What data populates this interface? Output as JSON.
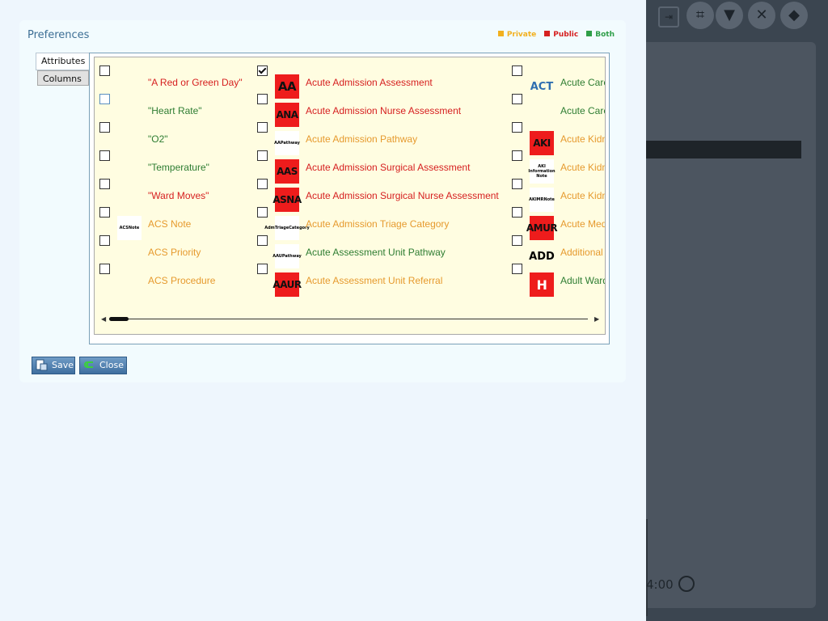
{
  "dialog": {
    "title": "Preferences",
    "legend": [
      {
        "label": "Private",
        "color": "#f2b01e"
      },
      {
        "label": "Public",
        "color": "#d62020"
      },
      {
        "label": "Both",
        "color": "#2e9e48"
      }
    ],
    "tabs": [
      {
        "label": "Attributes",
        "active": true
      },
      {
        "label": "Columns",
        "active": false
      }
    ],
    "buttons": {
      "save": "Save",
      "close": "Close"
    }
  },
  "columns": [
    {
      "items": [
        {
          "label": "\"A Red or Green Day\"",
          "scope": "public",
          "checked": false,
          "icon": null
        },
        {
          "label": "\"Heart Rate\"",
          "scope": "both",
          "checked": false,
          "icon": null
        },
        {
          "label": "\"O2\"",
          "scope": "both",
          "checked": false,
          "icon": null
        },
        {
          "label": "\"Temperature\"",
          "scope": "both",
          "checked": false,
          "icon": null
        },
        {
          "label": "\"Ward Moves\"",
          "scope": "public",
          "checked": false,
          "icon": null
        },
        {
          "label": "ACS Note",
          "scope": "private",
          "checked": false,
          "icon": {
            "type": "textlogo",
            "text": "ACSNote"
          }
        },
        {
          "label": "ACS Priority",
          "scope": "private",
          "checked": false,
          "icon": null
        },
        {
          "label": "ACS Procedure",
          "scope": "private",
          "checked": false,
          "icon": null
        }
      ]
    },
    {
      "items": [
        {
          "label": "Acute Admission Assessment",
          "scope": "public",
          "checked": true,
          "icon": {
            "type": "red",
            "text": "AA"
          }
        },
        {
          "label": "Acute Admission Nurse Assessment",
          "scope": "public",
          "checked": false,
          "icon": {
            "type": "red",
            "text": "ANA"
          }
        },
        {
          "label": "Acute Admission Pathway",
          "scope": "private",
          "checked": false,
          "icon": {
            "type": "textlogo",
            "text": "AAPathway"
          }
        },
        {
          "label": "Acute Admission Surgical  Assessment",
          "scope": "public",
          "checked": false,
          "icon": {
            "type": "red",
            "text": "AAS"
          }
        },
        {
          "label": "Acute Admission Surgical Nurse Assessment",
          "scope": "public",
          "checked": false,
          "icon": {
            "type": "red",
            "text": "ASNA"
          }
        },
        {
          "label": "Acute Admission Triage Category",
          "scope": "private",
          "checked": false,
          "icon": {
            "type": "textlogo",
            "text": "AdmTriageCategory"
          }
        },
        {
          "label": "Acute Assessment Unit Pathway",
          "scope": "both",
          "checked": false,
          "icon": {
            "type": "textlogo",
            "text": "AAUPathway"
          }
        },
        {
          "label": "Acute Assessment Unit Referral",
          "scope": "private",
          "checked": false,
          "icon": {
            "type": "red",
            "text": "AAUR"
          }
        }
      ]
    },
    {
      "items": [
        {
          "label": "Acute Care",
          "scope": "both",
          "checked": false,
          "icon": {
            "type": "plain",
            "text": "ACT",
            "color": "#2f6fb0"
          }
        },
        {
          "label": "Acute Care",
          "scope": "both",
          "checked": false,
          "icon": null
        },
        {
          "label": "Acute Kidn",
          "scope": "private",
          "checked": false,
          "icon": {
            "type": "red",
            "text": "AKI"
          }
        },
        {
          "label": "Acute Kidn",
          "scope": "private",
          "checked": false,
          "icon": {
            "type": "textlogo",
            "text": "AKI Information Note"
          }
        },
        {
          "label": "Acute Kidn",
          "scope": "private",
          "checked": false,
          "icon": {
            "type": "textlogo",
            "text": "AKIMRNote"
          }
        },
        {
          "label": "Acute Med",
          "scope": "private",
          "checked": false,
          "icon": {
            "type": "red",
            "text": "AMUR"
          }
        },
        {
          "label": "Additional",
          "scope": "private",
          "checked": false,
          "icon": {
            "type": "plain",
            "text": "ADD",
            "color": "#000000"
          }
        },
        {
          "label": "Adult Ward",
          "scope": "both",
          "checked": false,
          "icon": {
            "type": "red",
            "text": "H"
          }
        }
      ]
    }
  ],
  "background": {
    "time": "4:00"
  }
}
